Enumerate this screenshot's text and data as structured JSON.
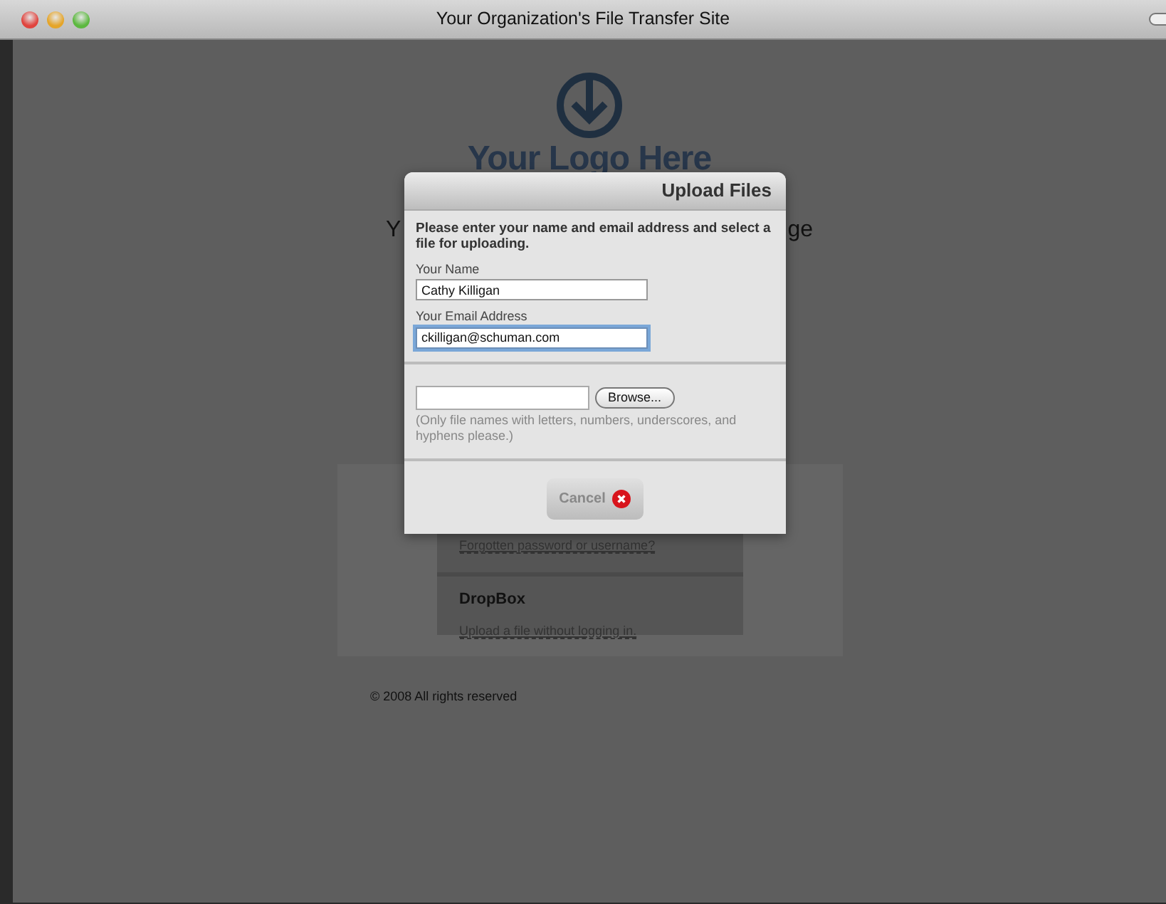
{
  "window": {
    "title": "Your Organization's File Transfer Site"
  },
  "page": {
    "logo_text": "Your Logo Here",
    "heading_parts": [
      "Y",
      "ge"
    ],
    "forgot_link": "Forgotten password or username?",
    "dropbox_title": "DropBox",
    "dropbox_link": "Upload a file without logging in.",
    "footer": "© 2008 All rights reserved"
  },
  "dialog": {
    "title": "Upload Files",
    "instructions": "Please enter your name and email address and select a file for uploading.",
    "fields": [
      {
        "label": "Your Name",
        "value": "Cathy Killigan",
        "focused": false
      },
      {
        "label": "Your Email Address",
        "value": "ckilligan@schuman.com",
        "focused": true
      }
    ],
    "browse_button": "Browse...",
    "file_note": "(Only file names with letters, numbers, underscores, and hyphens please.)",
    "cancel_button": "Cancel"
  }
}
